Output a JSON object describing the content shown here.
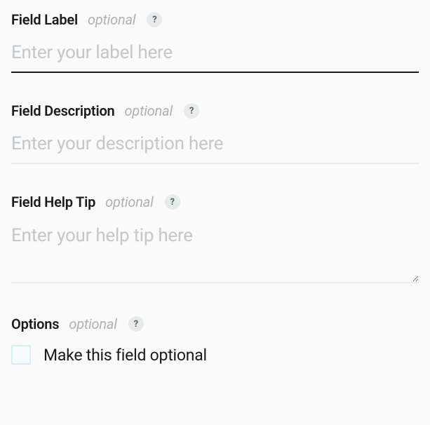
{
  "fields": {
    "label": {
      "title": "Field Label",
      "optional_tag": "optional",
      "placeholder": "Enter your label here",
      "value": ""
    },
    "description": {
      "title": "Field Description",
      "optional_tag": "optional",
      "placeholder": "Enter your description here",
      "value": ""
    },
    "helptip": {
      "title": "Field Help Tip",
      "optional_tag": "optional",
      "placeholder": "Enter your help tip here",
      "value": ""
    }
  },
  "options": {
    "title": "Options",
    "optional_tag": "optional",
    "make_optional_label": "Make this field optional"
  },
  "help_glyph": "?"
}
